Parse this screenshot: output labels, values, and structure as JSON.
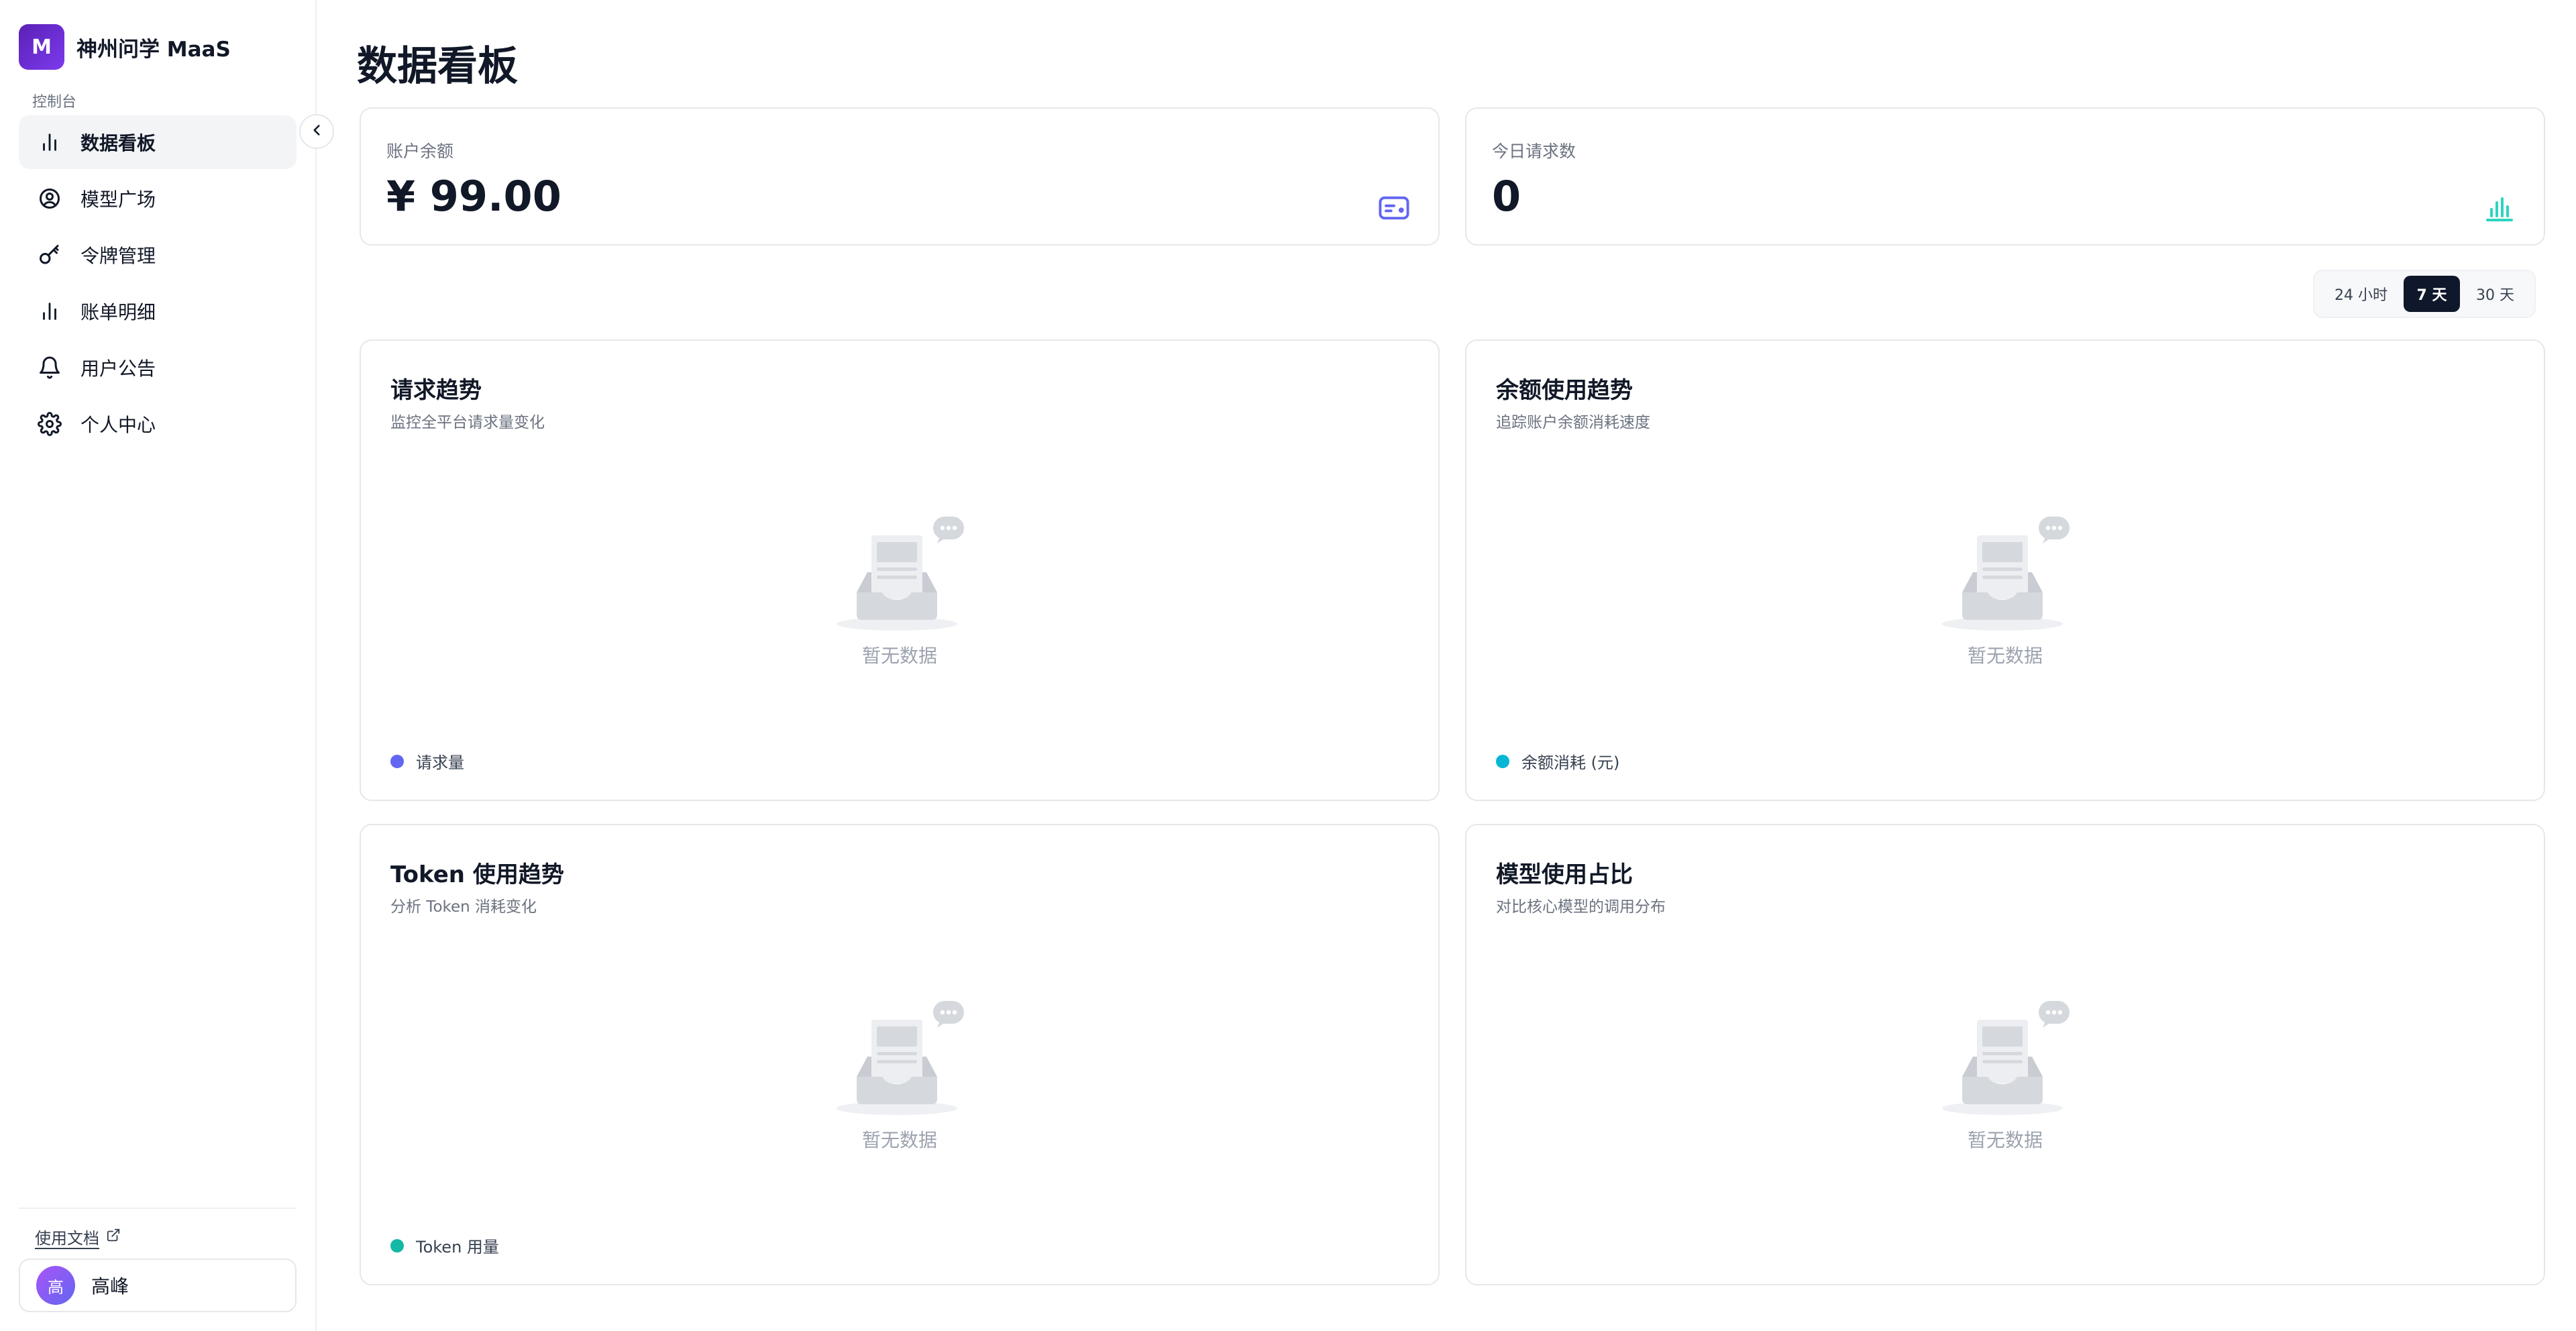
{
  "sidebar": {
    "brand_logo": "M",
    "brand_name": "神州问学 MaaS",
    "section_label": "控制台",
    "items": [
      {
        "label": "数据看板",
        "icon": "bar-chart-icon",
        "active": true
      },
      {
        "label": "模型广场",
        "icon": "user-circle-icon",
        "active": false
      },
      {
        "label": "令牌管理",
        "icon": "key-icon",
        "active": false
      },
      {
        "label": "账单明细",
        "icon": "bar-chart-icon",
        "active": false
      },
      {
        "label": "用户公告",
        "icon": "bell-icon",
        "active": false
      },
      {
        "label": "个人中心",
        "icon": "gear-icon",
        "active": false
      }
    ],
    "docs_link": "使用文档",
    "user": {
      "avatar_text": "高",
      "name": "高峰"
    }
  },
  "page": {
    "title": "数据看板"
  },
  "stats": [
    {
      "label": "账户余额",
      "value": "¥ 99.00",
      "icon": "wallet-card-icon",
      "icon_color": "#6366f1"
    },
    {
      "label": "今日请求数",
      "value": "0",
      "icon": "bar-chart-icon",
      "icon_color": "#2dd4bf"
    }
  ],
  "range": {
    "options": [
      "24 小时",
      "7 天",
      "30 天"
    ],
    "selected": "7 天"
  },
  "charts": [
    {
      "title": "请求趋势",
      "subtitle": "监控全平台请求量变化",
      "empty_text": "暂无数据",
      "legend": "请求量",
      "legend_color": "#6366f1"
    },
    {
      "title": "余额使用趋势",
      "subtitle": "追踪账户余额消耗速度",
      "empty_text": "暂无数据",
      "legend": "余额消耗 (元)",
      "legend_color": "#06b6d4"
    },
    {
      "title": "Token 使用趋势",
      "subtitle": "分析 Token 消耗变化",
      "empty_text": "暂无数据",
      "legend": "Token 用量",
      "legend_color": "#14b8a6"
    },
    {
      "title": "模型使用占比",
      "subtitle": "对比核心模型的调用分布",
      "empty_text": "暂无数据",
      "legend": "",
      "legend_color": ""
    }
  ],
  "colors": {
    "accent": "#0f172a",
    "brand": "#6d28d9"
  }
}
